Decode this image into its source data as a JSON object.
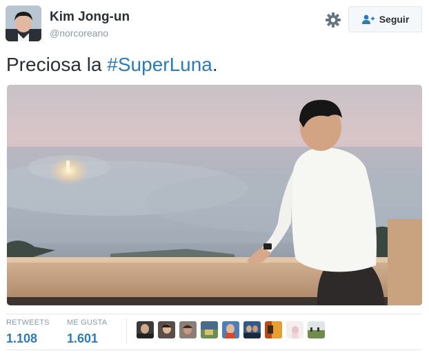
{
  "author": {
    "display_name": "Kim Jong-un",
    "handle": "@norcoreano"
  },
  "actions": {
    "follow_label": "Seguir"
  },
  "tweet": {
    "text_before": "Preciosa la ",
    "hashtag": "#SuperLuna",
    "text_after": "."
  },
  "stats": {
    "retweets_label": "RETWEETS",
    "retweets_value": "1.108",
    "likes_label": "ME GUSTA",
    "likes_value": "1.601"
  },
  "colors": {
    "link": "#2b7bb9",
    "muted": "#8899a6",
    "text": "#292f33",
    "border": "#e1e8ed"
  },
  "icons": [
    "gear-icon",
    "add-user-icon"
  ]
}
